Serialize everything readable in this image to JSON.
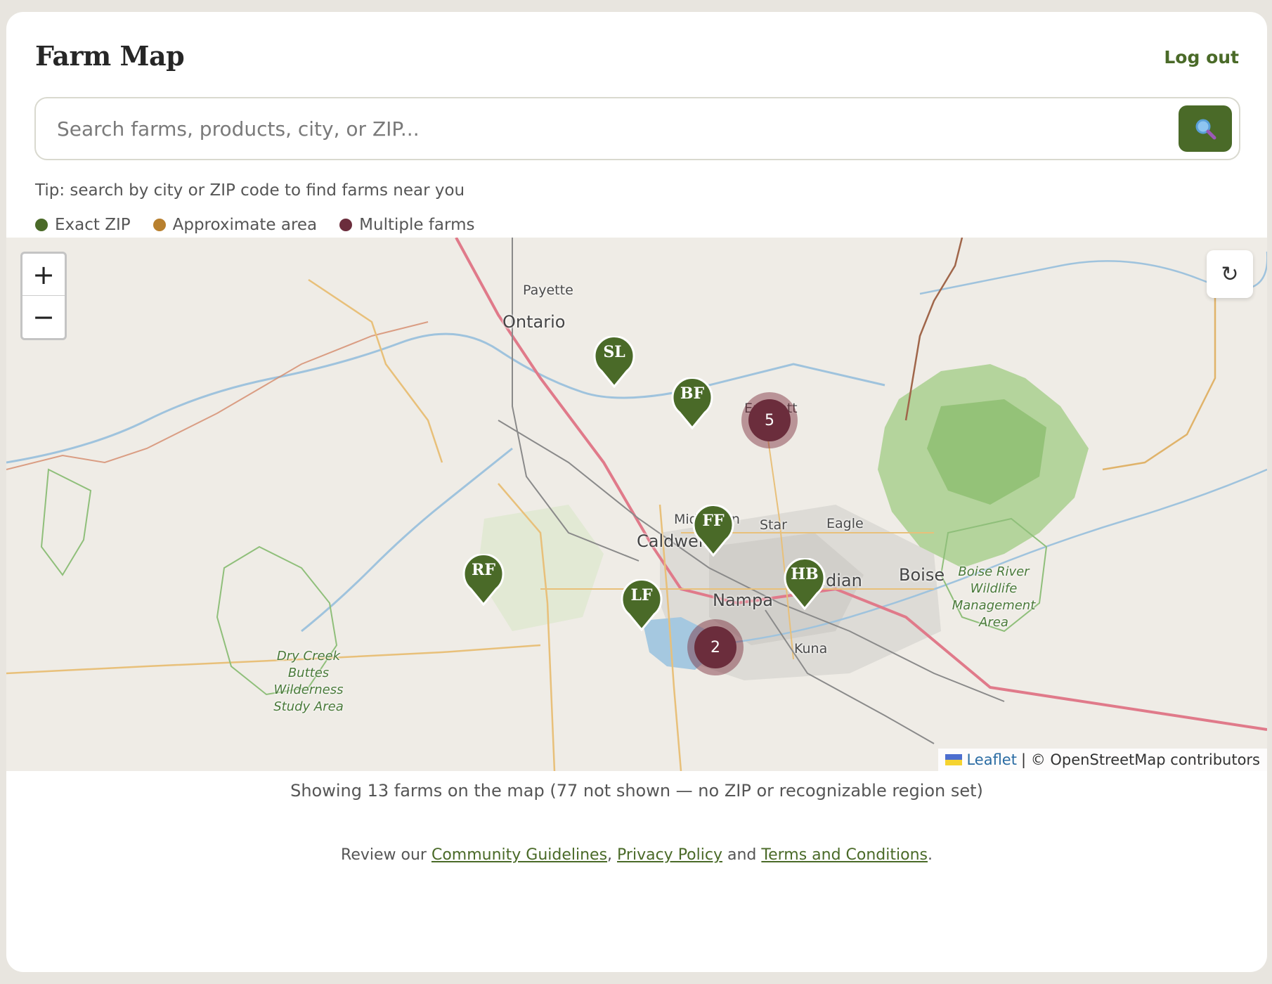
{
  "header": {
    "title": "Farm Map",
    "logout_label": "Log out"
  },
  "search": {
    "placeholder": "Search farms, products, city, or ZIP...",
    "value": "",
    "button_icon": "search-icon"
  },
  "tip": "Tip: search by city or ZIP code to find farms near you",
  "legend": [
    {
      "label": "Exact ZIP",
      "color": "#4a6a28"
    },
    {
      "label": "Approximate area",
      "color": "#b8802e"
    },
    {
      "label": "Multiple farms",
      "color": "#6b2d3c"
    }
  ],
  "map": {
    "zoom_in": "+",
    "zoom_out": "−",
    "reset_icon": "↻",
    "place_labels": {
      "payette": "Payette",
      "ontario": "Ontario",
      "emmett": "Emmett",
      "middleton": "Middleton",
      "star": "Star",
      "eagle": "Eagle",
      "caldwell": "Caldwell",
      "meridian": "Meridian",
      "boise": "Boise",
      "nampa": "Nampa",
      "kuna": "Kuna"
    },
    "park_labels": {
      "boise_river": "Boise River Wildlife Management Area",
      "dry_creek": "Dry Creek Buttes Wilderness Study Area"
    },
    "pins": {
      "sl": "SL",
      "bf": "BF",
      "ff": "FF",
      "rf": "RF",
      "lf": "LF",
      "hb": "HB"
    },
    "clusters": {
      "emmett": "5",
      "nampa": "2"
    },
    "attribution": {
      "leaflet": "Leaflet",
      "osm": "| © OpenStreetMap contributors"
    }
  },
  "summary": "Showing 13 farms on the map (77 not shown — no ZIP or recognizable region set)",
  "footer": {
    "prefix": "Review our",
    "community": "Community Guidelines",
    "comma": ",",
    "privacy": "Privacy Policy",
    "and": "and",
    "terms": "Terms and Conditions",
    "period": "."
  }
}
